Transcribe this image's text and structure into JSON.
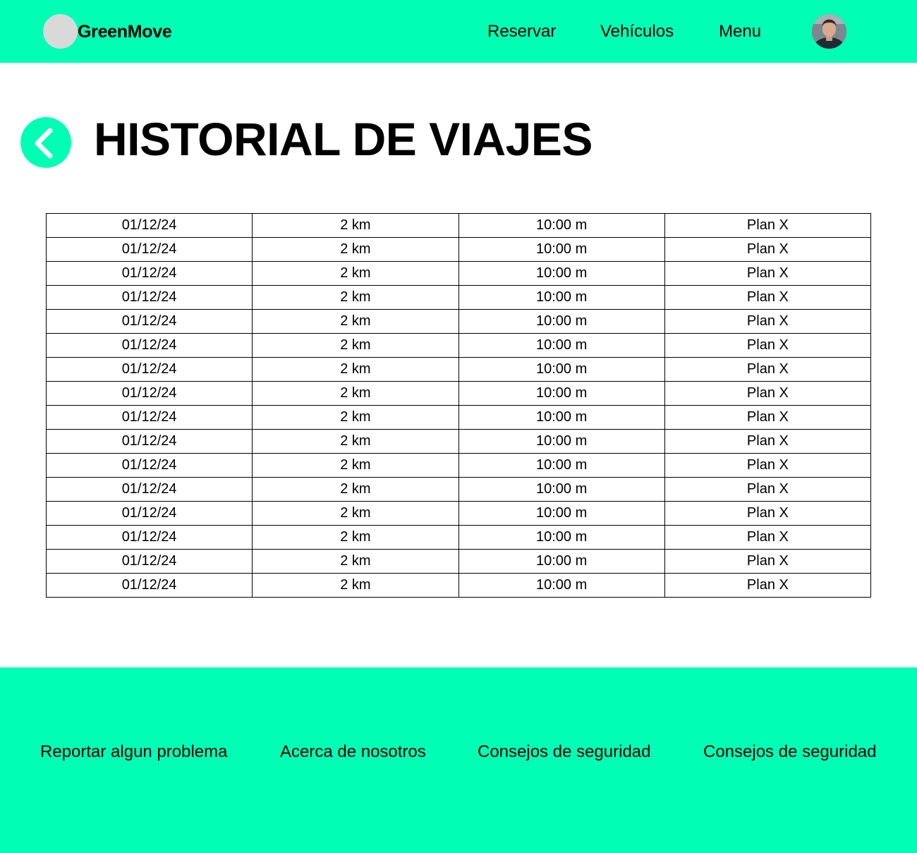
{
  "header": {
    "brand": "GreenMove",
    "nav": {
      "reservar": "Reservar",
      "vehiculos": "Vehículos",
      "menu": "Menu"
    },
    "avatar_icon": "user-avatar"
  },
  "main": {
    "back_icon": "chevron-left-icon",
    "title": "HISTORIAL DE VIAJES",
    "trips": [
      [
        "01/12/24",
        "2 km",
        "10:00 m",
        "Plan X"
      ],
      [
        "01/12/24",
        "2 km",
        "10:00 m",
        "Plan X"
      ],
      [
        "01/12/24",
        "2 km",
        "10:00 m",
        "Plan X"
      ],
      [
        "01/12/24",
        "2 km",
        "10:00 m",
        "Plan X"
      ],
      [
        "01/12/24",
        "2 km",
        "10:00 m",
        "Plan X"
      ],
      [
        "01/12/24",
        "2 km",
        "10:00 m",
        "Plan X"
      ],
      [
        "01/12/24",
        "2 km",
        "10:00 m",
        "Plan X"
      ],
      [
        "01/12/24",
        "2 km",
        "10:00 m",
        "Plan X"
      ],
      [
        "01/12/24",
        "2 km",
        "10:00 m",
        "Plan X"
      ],
      [
        "01/12/24",
        "2 km",
        "10:00 m",
        "Plan X"
      ],
      [
        "01/12/24",
        "2 km",
        "10:00 m",
        "Plan X"
      ],
      [
        "01/12/24",
        "2 km",
        "10:00 m",
        "Plan X"
      ],
      [
        "01/12/24",
        "2 km",
        "10:00 m",
        "Plan X"
      ],
      [
        "01/12/24",
        "2 km",
        "10:00 m",
        "Plan X"
      ],
      [
        "01/12/24",
        "2 km",
        "10:00 m",
        "Plan X"
      ],
      [
        "01/12/24",
        "2 km",
        "10:00 m",
        "Plan X"
      ]
    ]
  },
  "footer": {
    "links": [
      "Reportar algun problema",
      "Acerca de nosotros",
      "Consejos de seguridad",
      "Consejos de seguridad"
    ]
  },
  "colors": {
    "accent": "#00ffb4",
    "logo_placeholder": "#d9d9d9",
    "text": "#000000"
  }
}
